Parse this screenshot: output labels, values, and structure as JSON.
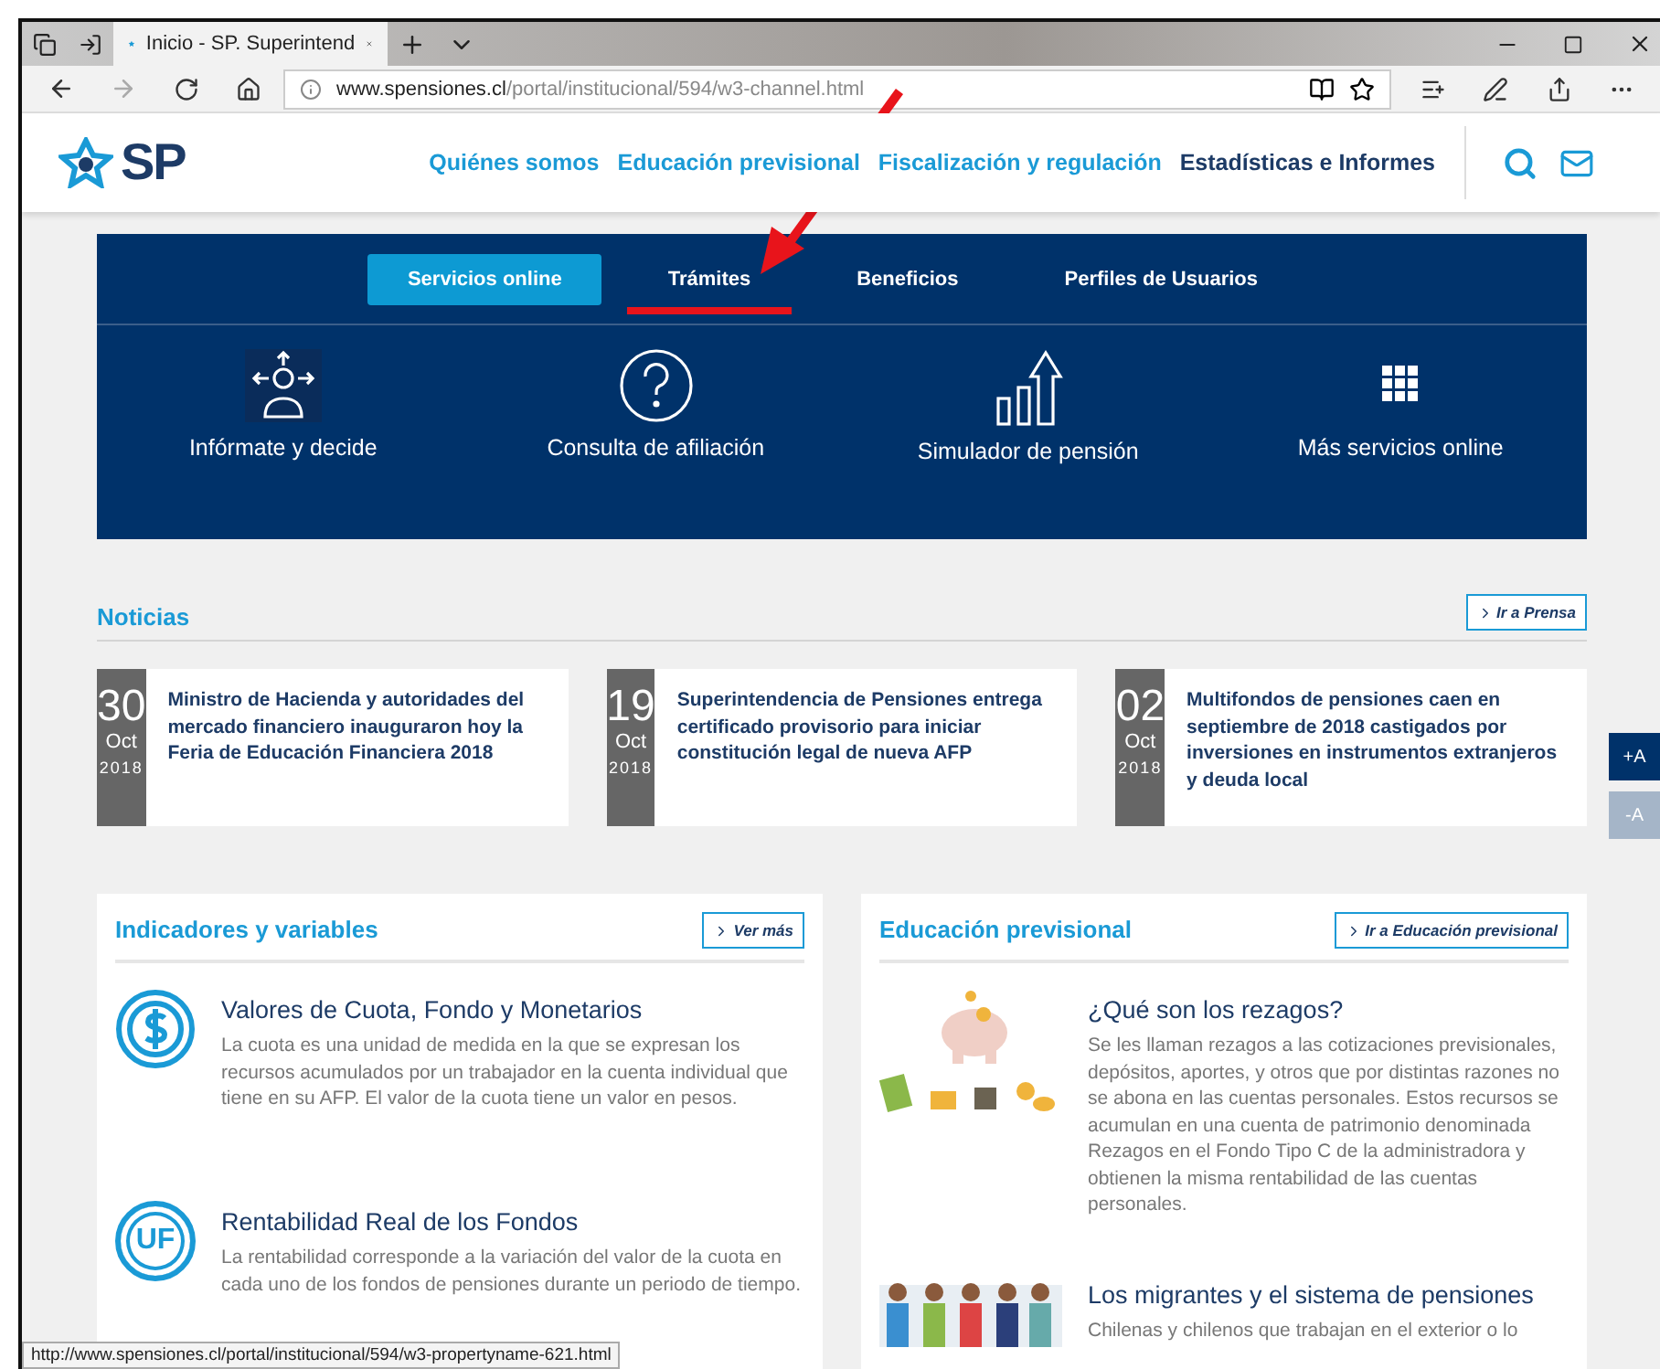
{
  "browser": {
    "tab_title": "Inicio - SP. Superintend",
    "url_host": "www.spensiones.cl",
    "url_path": "/portal/institucional/594/w3-channel.html"
  },
  "site": {
    "logo": "SP",
    "nav": [
      {
        "label": "Quiénes somos",
        "selected": false
      },
      {
        "label": "Educación previsional",
        "selected": false
      },
      {
        "label": "Fiscalización y regulación",
        "selected": false
      },
      {
        "label": "Estadísticas e Informes",
        "selected": true
      }
    ]
  },
  "services_panel": {
    "tabs": [
      {
        "label": "Servicios online",
        "selected": true,
        "annotated": false
      },
      {
        "label": "Trámites",
        "selected": false,
        "annotated": true
      },
      {
        "label": "Beneficios",
        "selected": false,
        "annotated": false
      },
      {
        "label": "Perfiles de Usuarios",
        "selected": false,
        "annotated": false
      }
    ],
    "items": [
      {
        "label": "Infórmate y decide",
        "kind": "person"
      },
      {
        "label": "Consulta de afiliación",
        "kind": "question"
      },
      {
        "label": "Simulador de pensión",
        "kind": "chart"
      },
      {
        "label": "Más servicios online",
        "kind": "grid"
      }
    ]
  },
  "news": {
    "title": "Noticias",
    "link": "Ir a Prensa",
    "items": [
      {
        "day": "30",
        "month": "Oct",
        "year": "2018",
        "headline": "Ministro de Hacienda y autoridades del mercado financiero inauguraron hoy la Feria de Educación Financiera 2018"
      },
      {
        "day": "19",
        "month": "Oct",
        "year": "2018",
        "headline": "Superintendencia de Pensiones entrega certificado provisorio para iniciar constitución legal de nueva AFP"
      },
      {
        "day": "02",
        "month": "Oct",
        "year": "2018",
        "headline": "Multifondos de pensiones caen en septiembre de 2018 castigados por inversiones en instrumentos extranjeros y deuda local"
      }
    ]
  },
  "font_buttons": [
    {
      "label": "+A",
      "disabled": false
    },
    {
      "label": "-A",
      "disabled": true
    }
  ],
  "sections": [
    {
      "title": "Indicadores y variables",
      "link": "Ver más",
      "entries": [
        {
          "kind": "dollar",
          "title": "Valores de Cuota, Fondo y Monetarios",
          "text": "La cuota es una unidad de medida en la que se expresan los recursos acumulados por un trabajador en la cuenta individual que tiene en su AFP. El valor de la cuota tiene un valor en pesos."
        },
        {
          "kind": "uf",
          "badge": "UF",
          "title": "Rentabilidad Real de los Fondos",
          "text": "La rentabilidad corresponde a la variación del valor de la cuota en cada uno de los fondos de pensiones durante un periodo de tiempo."
        }
      ]
    },
    {
      "title": "Educación previsional",
      "link": "Ir a Educación previsional",
      "entries": [
        {
          "kind": "savings",
          "title": "¿Qué son los rezagos?",
          "text": "Se les llaman rezagos a las cotizaciones previsionales, depósitos, aportes, y otros que por distintas razones no se abona en las cuentas personales. Estos recursos se acumulan en una cuenta de patrimonio denominada Rezagos en el Fondo Tipo C de la administradora y obtienen la misma rentabilidad de las cuentas personales."
        },
        {
          "kind": "people",
          "title": "Los migrantes y el sistema de pensiones",
          "text": "Chilenas y chilenos que trabajan en el exterior o lo"
        }
      ]
    }
  ],
  "status_bar": "http://www.spensiones.cl/portal/institucional/594/w3-propertyname-621.html"
}
